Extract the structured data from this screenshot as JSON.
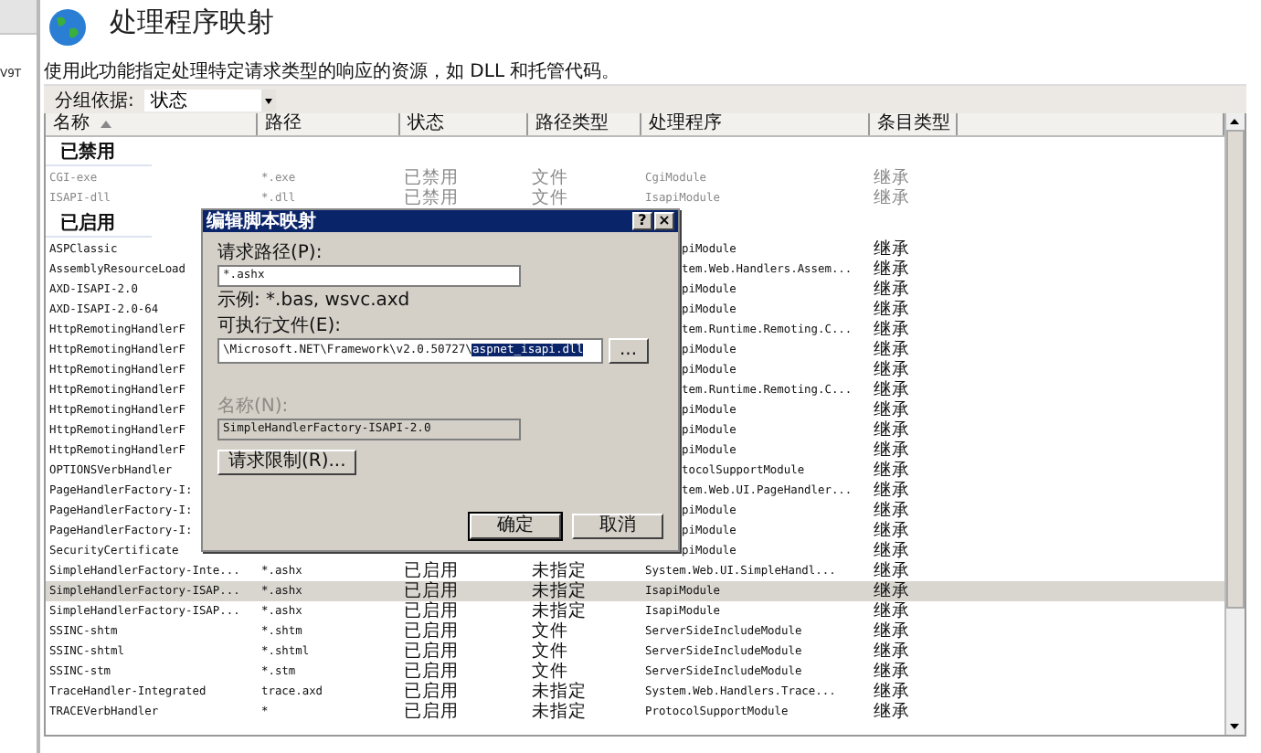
{
  "left_pane": {
    "text": "V9T"
  },
  "page": {
    "title": "处理程序映射",
    "description": "使用此功能指定处理特定请求类型的响应的资源，如 DLL 和托管代码。"
  },
  "group_by": {
    "label": "分组依据:",
    "value": "状态"
  },
  "table": {
    "columns": [
      {
        "label": "名称",
        "sorted": true
      },
      {
        "label": "路径",
        "sorted": false
      },
      {
        "label": "状态",
        "sorted": false
      },
      {
        "label": "路径类型",
        "sorted": false
      },
      {
        "label": "处理程序",
        "sorted": false
      },
      {
        "label": "条目类型",
        "sorted": false
      }
    ],
    "rows": [
      {
        "kind": "group",
        "label": "已禁用"
      },
      {
        "kind": "row",
        "disabled": true,
        "selected": false,
        "cells": [
          "CGI-exe",
          "*.exe",
          "已禁用",
          "文件",
          "CgiModule",
          "继承"
        ]
      },
      {
        "kind": "row",
        "disabled": true,
        "selected": false,
        "cells": [
          "ISAPI-dll",
          "*.dll",
          "已禁用",
          "文件",
          "IsapiModule",
          "继承"
        ]
      },
      {
        "kind": "group",
        "label": "已启用"
      },
      {
        "kind": "partial",
        "selected": false,
        "name": "ASPClassic",
        "handler": "piModule",
        "entry_type": "继承"
      },
      {
        "kind": "partial",
        "selected": false,
        "name": "AssemblyResourceLoad",
        "handler": "tem.Web.Handlers.Assem...",
        "entry_type": "继承"
      },
      {
        "kind": "partial",
        "selected": false,
        "name": "AXD-ISAPI-2.0",
        "handler": "piModule",
        "entry_type": "继承"
      },
      {
        "kind": "partial",
        "selected": false,
        "name": "AXD-ISAPI-2.0-64",
        "handler": "piModule",
        "entry_type": "继承"
      },
      {
        "kind": "partial",
        "selected": false,
        "name": "HttpRemotingHandlerF",
        "handler": "tem.Runtime.Remoting.C...",
        "entry_type": "继承"
      },
      {
        "kind": "partial",
        "selected": false,
        "name": "HttpRemotingHandlerF",
        "handler": "piModule",
        "entry_type": "继承"
      },
      {
        "kind": "partial",
        "selected": false,
        "name": "HttpRemotingHandlerF",
        "handler": "piModule",
        "entry_type": "继承"
      },
      {
        "kind": "partial",
        "selected": false,
        "name": "HttpRemotingHandlerF",
        "handler": "tem.Runtime.Remoting.C...",
        "entry_type": "继承"
      },
      {
        "kind": "partial",
        "selected": false,
        "name": "HttpRemotingHandlerF",
        "handler": "piModule",
        "entry_type": "继承"
      },
      {
        "kind": "partial",
        "selected": false,
        "name": "HttpRemotingHandlerF",
        "handler": "piModule",
        "entry_type": "继承"
      },
      {
        "kind": "partial",
        "selected": false,
        "name": "HttpRemotingHandlerF",
        "handler": "piModule",
        "entry_type": "继承"
      },
      {
        "kind": "partial",
        "selected": false,
        "name": "OPTIONSVerbHandler",
        "handler": "tocolSupportModule",
        "entry_type": "继承"
      },
      {
        "kind": "partial",
        "selected": false,
        "name": "PageHandlerFactory-I:",
        "handler": "tem.Web.UI.PageHandler...",
        "entry_type": "继承"
      },
      {
        "kind": "partial",
        "selected": false,
        "name": "PageHandlerFactory-I:",
        "handler": "piModule",
        "entry_type": "继承"
      },
      {
        "kind": "partial",
        "selected": false,
        "name": "PageHandlerFactory-I:",
        "handler": "piModule",
        "entry_type": "继承"
      },
      {
        "kind": "partial",
        "selected": false,
        "name": "SecurityCertificate",
        "handler": "piModule",
        "entry_type": "继承"
      },
      {
        "kind": "row",
        "disabled": false,
        "selected": false,
        "cells": [
          "SimpleHandlerFactory-Inte...",
          "*.ashx",
          "已启用",
          "未指定",
          "System.Web.UI.SimpleHandl...",
          "继承"
        ]
      },
      {
        "kind": "row",
        "disabled": false,
        "selected": true,
        "cells": [
          "SimpleHandlerFactory-ISAP...",
          "*.ashx",
          "已启用",
          "未指定",
          "IsapiModule",
          "继承"
        ]
      },
      {
        "kind": "row",
        "disabled": false,
        "selected": false,
        "cells": [
          "SimpleHandlerFactory-ISAP...",
          "*.ashx",
          "已启用",
          "未指定",
          "IsapiModule",
          "继承"
        ]
      },
      {
        "kind": "row",
        "disabled": false,
        "selected": false,
        "cells": [
          "SSINC-shtm",
          "*.shtm",
          "已启用",
          "文件",
          "ServerSideIncludeModule",
          "继承"
        ]
      },
      {
        "kind": "row",
        "disabled": false,
        "selected": false,
        "cells": [
          "SSINC-shtml",
          "*.shtml",
          "已启用",
          "文件",
          "ServerSideIncludeModule",
          "继承"
        ]
      },
      {
        "kind": "row",
        "disabled": false,
        "selected": false,
        "cells": [
          "SSINC-stm",
          "*.stm",
          "已启用",
          "文件",
          "ServerSideIncludeModule",
          "继承"
        ]
      },
      {
        "kind": "row",
        "disabled": false,
        "selected": false,
        "cells": [
          "TraceHandler-Integrated",
          "trace.axd",
          "已启用",
          "未指定",
          "System.Web.Handlers.Trace...",
          "继承"
        ]
      },
      {
        "kind": "row",
        "disabled": false,
        "selected": false,
        "cells": [
          "TRACEVerbHandler",
          "*",
          "已启用",
          "未指定",
          "ProtocolSupportModule",
          "继承"
        ]
      }
    ]
  },
  "dialog": {
    "title": "编辑脚本映射",
    "help_button": "?",
    "close_button": "×",
    "request_path": {
      "label": "请求路径(P):",
      "value": "*.ashx"
    },
    "example": "示例: *.bas, wsvc.axd",
    "executable": {
      "label": "可执行文件(E):",
      "value": "\\Microsoft.NET\\Framework\\v2.0.50727\\",
      "selected_text": "aspnet_isapi.dll",
      "browse_button": "..."
    },
    "name": {
      "label": "名称(N):",
      "value": "SimpleHandlerFactory-ISAPI-2.0",
      "disabled": true
    },
    "restrictions_button": "请求限制(R)...",
    "ok_button": "确定",
    "cancel_button": "取消"
  }
}
